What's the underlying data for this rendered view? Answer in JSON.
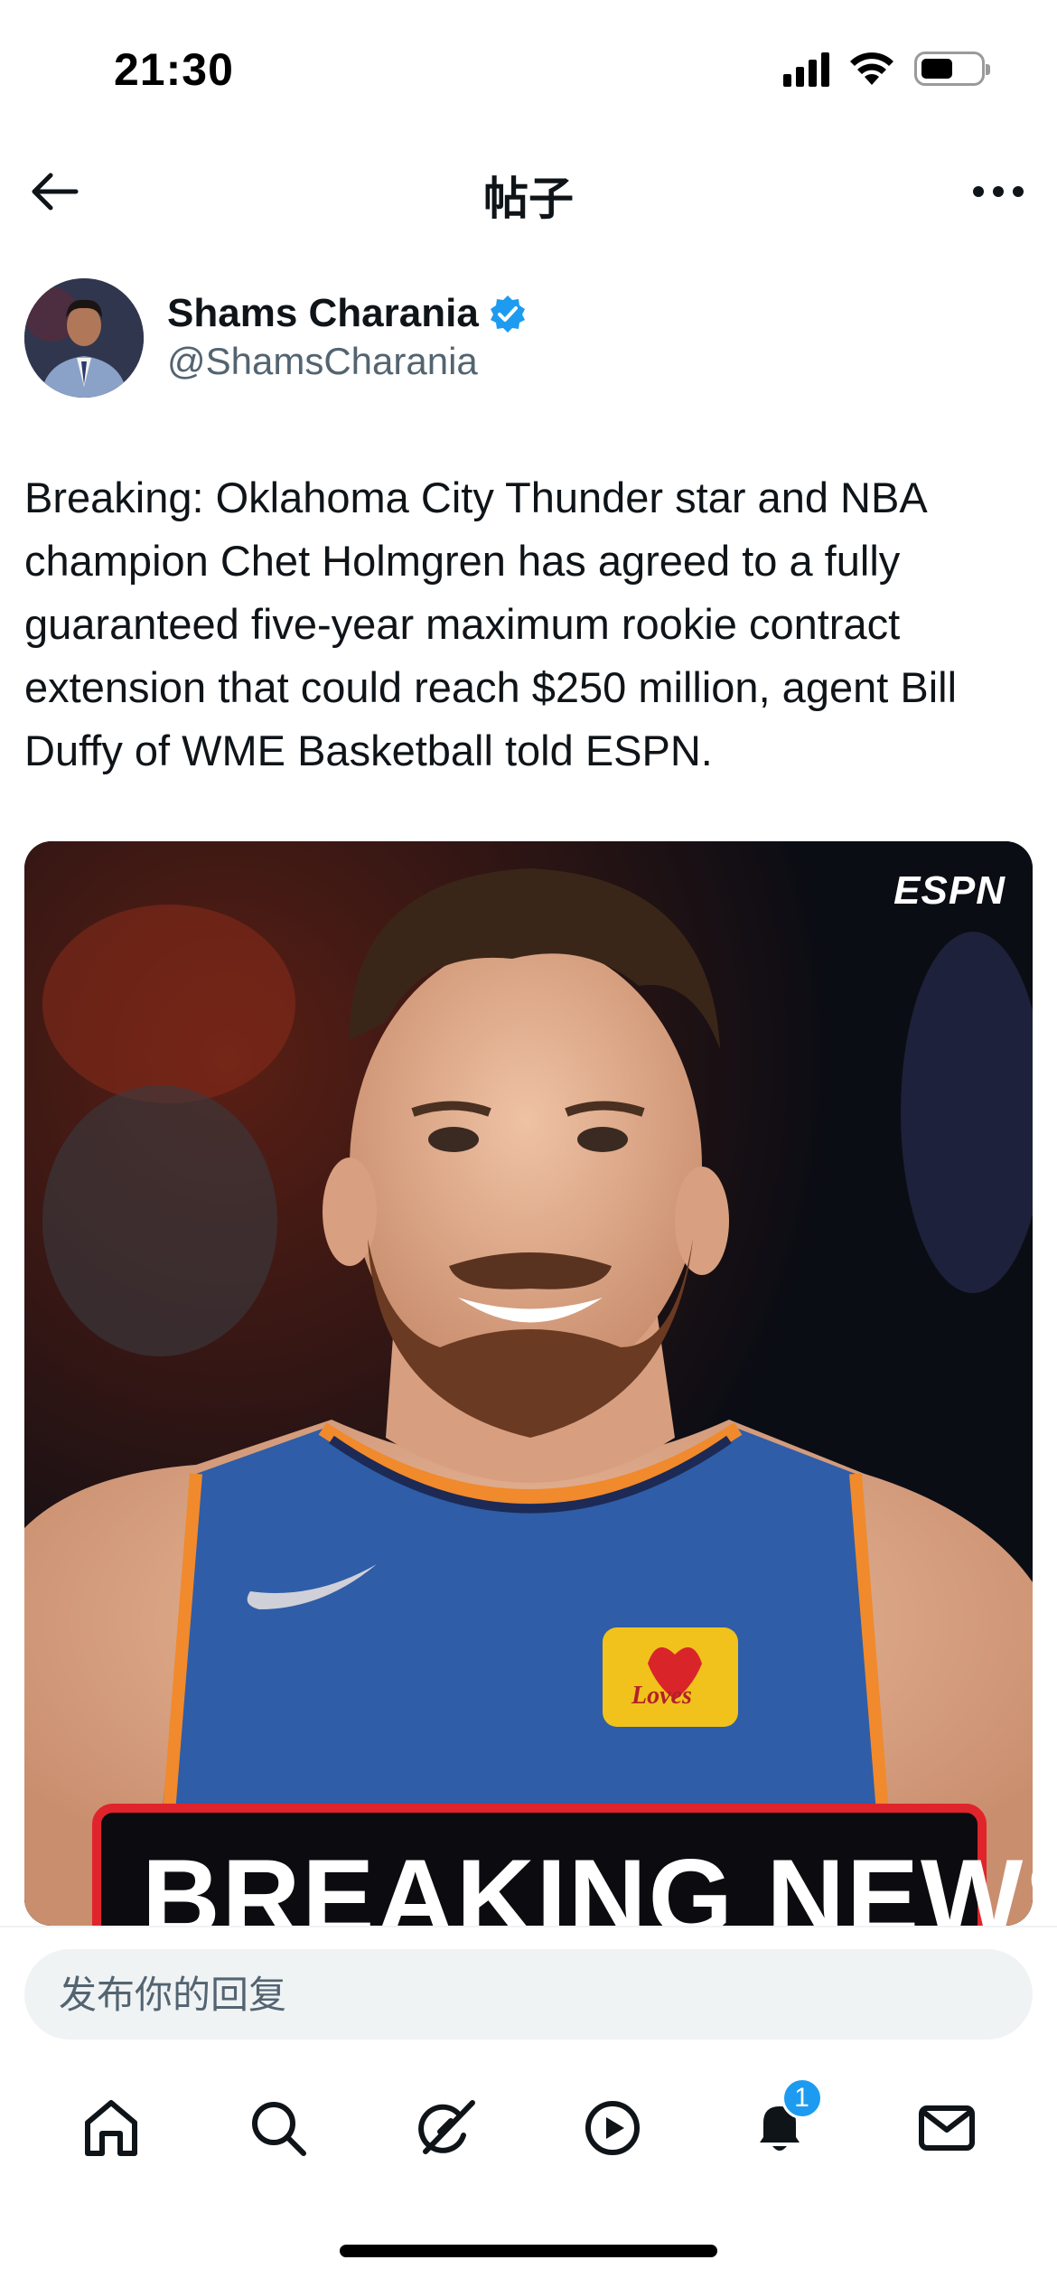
{
  "status_bar": {
    "time": "21:30",
    "battery_level": 0.55,
    "icons": [
      "signal-icon",
      "wifi-icon",
      "battery-icon"
    ]
  },
  "nav": {
    "title": "帖子",
    "icons": [
      "back-arrow-icon",
      "more-icon"
    ]
  },
  "author": {
    "name": "Shams Charania",
    "handle": "@ShamsCharania",
    "verified": true,
    "verified_color": "#1d9bf0"
  },
  "tweet": {
    "text": "Breaking: Oklahoma City Thunder star and NBA champion Chet Holmgren has agreed to a fully guaranteed five-year maximum rookie contract extension that could reach $250 million, agent Bill Duffy of WME Basketball told ESPN."
  },
  "media": {
    "logo": "ESPN",
    "banner_text": "BREAKING NEWS",
    "jersey_logo": "Loves"
  },
  "reply": {
    "placeholder": "发布你的回复"
  },
  "tabbar": {
    "items": [
      "home-icon",
      "search-icon",
      "grok-icon",
      "video-icon",
      "notifications-icon",
      "messages-icon"
    ],
    "notification_count": "1"
  },
  "colors": {
    "text": "#0f1419",
    "secondary": "#536471",
    "accent": "#1d9bf0",
    "banner_red": "#e0242b"
  }
}
